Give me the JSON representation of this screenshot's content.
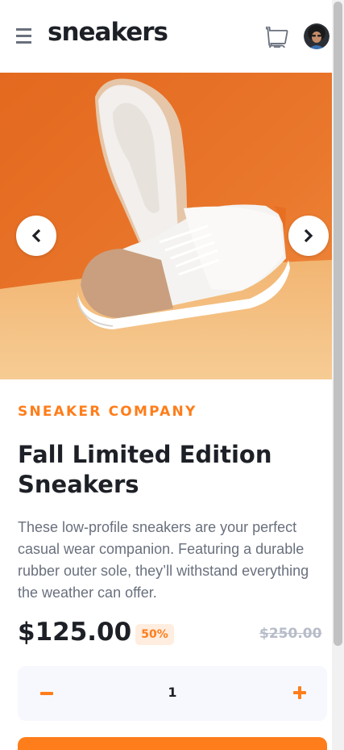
{
  "header": {
    "logo_text": "sneakers",
    "menu_icon": "hamburger-menu-icon",
    "cart_icon": "cart-icon",
    "avatar": "user-avatar"
  },
  "gallery": {
    "prev_icon": "chevron-left-icon",
    "next_icon": "chevron-right-icon"
  },
  "product": {
    "company": "SNEAKER COMPANY",
    "title": "Fall Limited Edition Sneakers",
    "description": "These low-profile sneakers are your perfect casual wear companion. Featuring a durable rubber outer sole, they’ll withstand everything the weather can offer.",
    "price": "$125.00",
    "discount": "50%",
    "original_price": "$250.00"
  },
  "quantity": {
    "value": "1",
    "minus_icon": "minus-icon",
    "plus_icon": "plus-icon"
  },
  "colors": {
    "accent": "#ff7d1a",
    "accent_light": "#ffede0",
    "text_dark": "#1d2026",
    "text_grey": "#69707d",
    "muted": "#b6bcc8"
  }
}
